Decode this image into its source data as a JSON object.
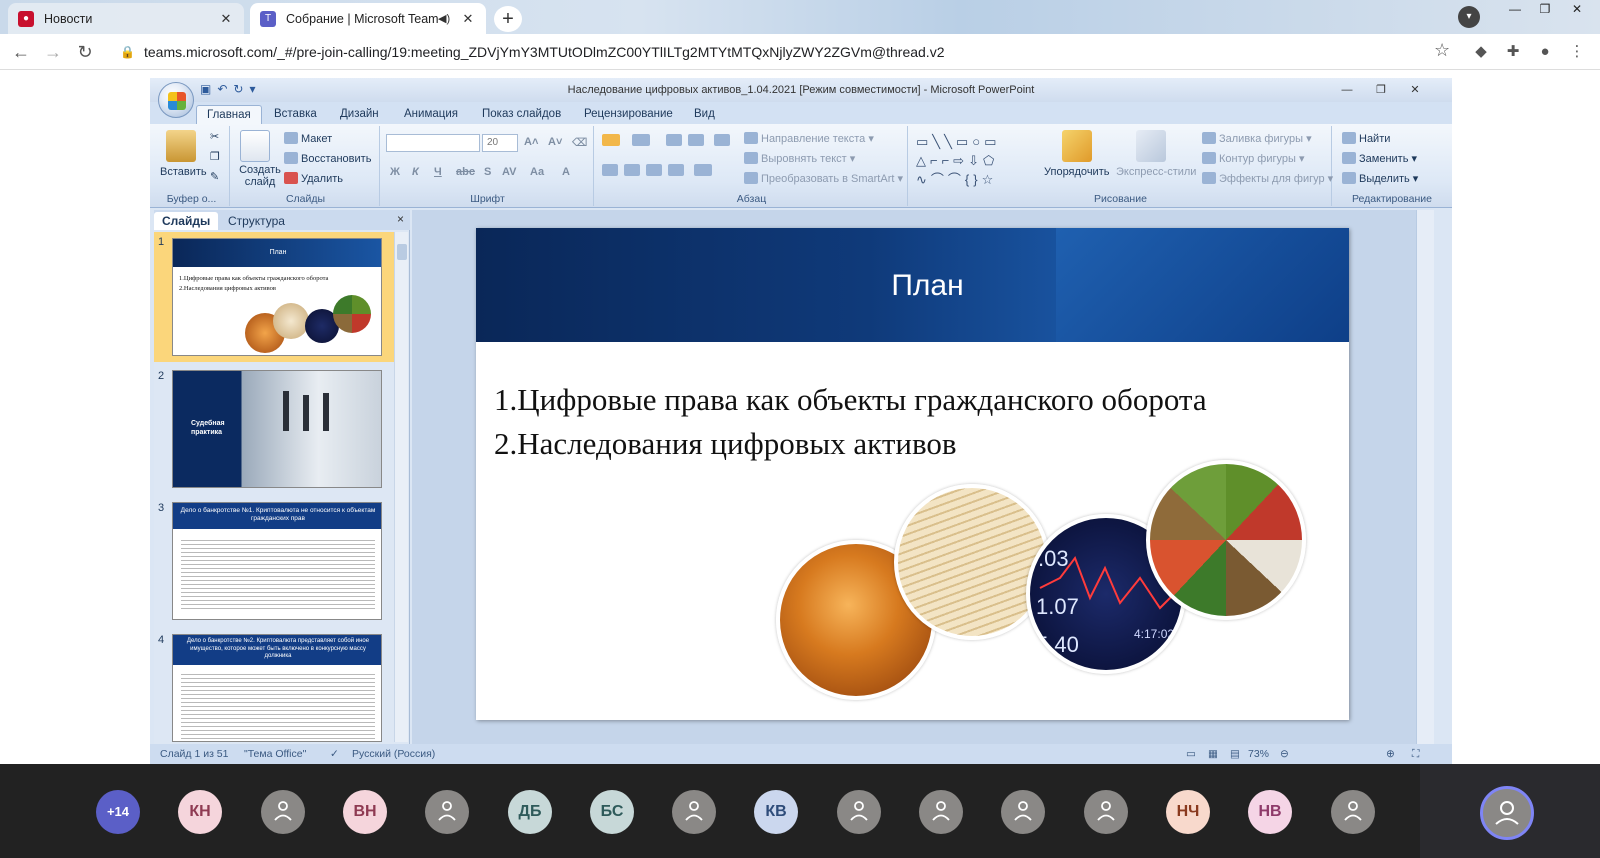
{
  "browser": {
    "tabs": [
      {
        "label": "Новости",
        "active": false
      },
      {
        "label": "Собрание | Microsoft Teams",
        "active": true
      }
    ],
    "url": "teams.microsoft.com/_#/pre-join-calling/19:meeting_ZDVjYmY3MTUtODlmZC00YTlILTg2MTYtMTQxNjlyZWY2ZGVm@thread.v2"
  },
  "ppt": {
    "title": "Наследование цифровых активов_1.04.2021 [Режим совместимости] - Microsoft PowerPoint",
    "ribbon_tabs": [
      "Главная",
      "Вставка",
      "Дизайн",
      "Анимация",
      "Показ слайдов",
      "Рецензирование",
      "Вид"
    ],
    "groups": {
      "clipboard": {
        "label": "Буфер о...",
        "paste": "Вставить"
      },
      "slides": {
        "label": "Слайды",
        "create": "Создать слайд",
        "layout": "Макет",
        "reset": "Восстановить",
        "delete": "Удалить"
      },
      "font": {
        "label": "Шрифт",
        "size": "20"
      },
      "paragraph": {
        "label": "Абзац",
        "text_direction": "Направление текста",
        "align_text": "Выровнять текст",
        "smartart": "Преобразовать в SmartArt"
      },
      "drawing": {
        "label": "Рисование",
        "arrange": "Упорядочить",
        "quick_styles": "Экспресс-стили",
        "fill": "Заливка фигуры",
        "outline": "Контур фигуры",
        "effects": "Эффекты для фигур"
      },
      "editing": {
        "label": "Редактирование",
        "find": "Найти",
        "replace": "Заменить",
        "select": "Выделить"
      }
    },
    "panel_tabs": [
      "Слайды",
      "Структура"
    ],
    "thumbnails": [
      {
        "num": "1",
        "title": "План",
        "lines": [
          "1.Цифровые права как объекты гражданского оборота",
          "2.Наследования цифровых активов"
        ]
      },
      {
        "num": "2",
        "title": "Судебная практика"
      },
      {
        "num": "3",
        "title": "Дело о банкротстве №1. Криптовалюта не относится к объектам гражданских прав"
      },
      {
        "num": "4",
        "title": "Дело о банкротстве №2. Криптовалюта представляет собой иное имущество, которое может быть включено в конкурсную массу должника"
      }
    ],
    "slide": {
      "title": "План",
      "lines": [
        "1.Цифровые права как объекты гражданского оборота",
        "2.Наследования цифровых активов"
      ]
    },
    "status": {
      "slide": "Слайд 1 из 51",
      "theme": "\"Тема Office\"",
      "language": "Русский (Россия)",
      "zoom": "73%"
    }
  },
  "participants": {
    "overflow": "+14",
    "avatars": [
      {
        "initials": "КН",
        "bg": "#f5d5dc",
        "fg": "#8e3a52"
      },
      {
        "initials": "",
        "bg": "#8a8886",
        "fg": "#ffffff"
      },
      {
        "initials": "ВН",
        "bg": "#f5d5dc",
        "fg": "#8e3a52"
      },
      {
        "initials": "",
        "bg": "#8a8886",
        "fg": "#ffffff"
      },
      {
        "initials": "ДБ",
        "bg": "#c7d8d8",
        "fg": "#2e5a5a"
      },
      {
        "initials": "БС",
        "bg": "#c7d8d8",
        "fg": "#2e5a5a"
      },
      {
        "initials": "",
        "bg": "#8a8886",
        "fg": "#ffffff"
      },
      {
        "initials": "КВ",
        "bg": "#cbd7ee",
        "fg": "#2e4c7a"
      },
      {
        "initials": "",
        "bg": "#8a8886",
        "fg": "#ffffff"
      },
      {
        "initials": "",
        "bg": "#8a8886",
        "fg": "#ffffff"
      },
      {
        "initials": "",
        "bg": "#8a8886",
        "fg": "#ffffff"
      },
      {
        "initials": "",
        "bg": "#8a8886",
        "fg": "#ffffff"
      },
      {
        "initials": "НЧ",
        "bg": "#f8d9cc",
        "fg": "#8a3a1f"
      },
      {
        "initials": "НВ",
        "bg": "#f5d5e6",
        "fg": "#8e3a6a"
      },
      {
        "initials": "",
        "bg": "#8a8886",
        "fg": "#ffffff"
      }
    ]
  }
}
